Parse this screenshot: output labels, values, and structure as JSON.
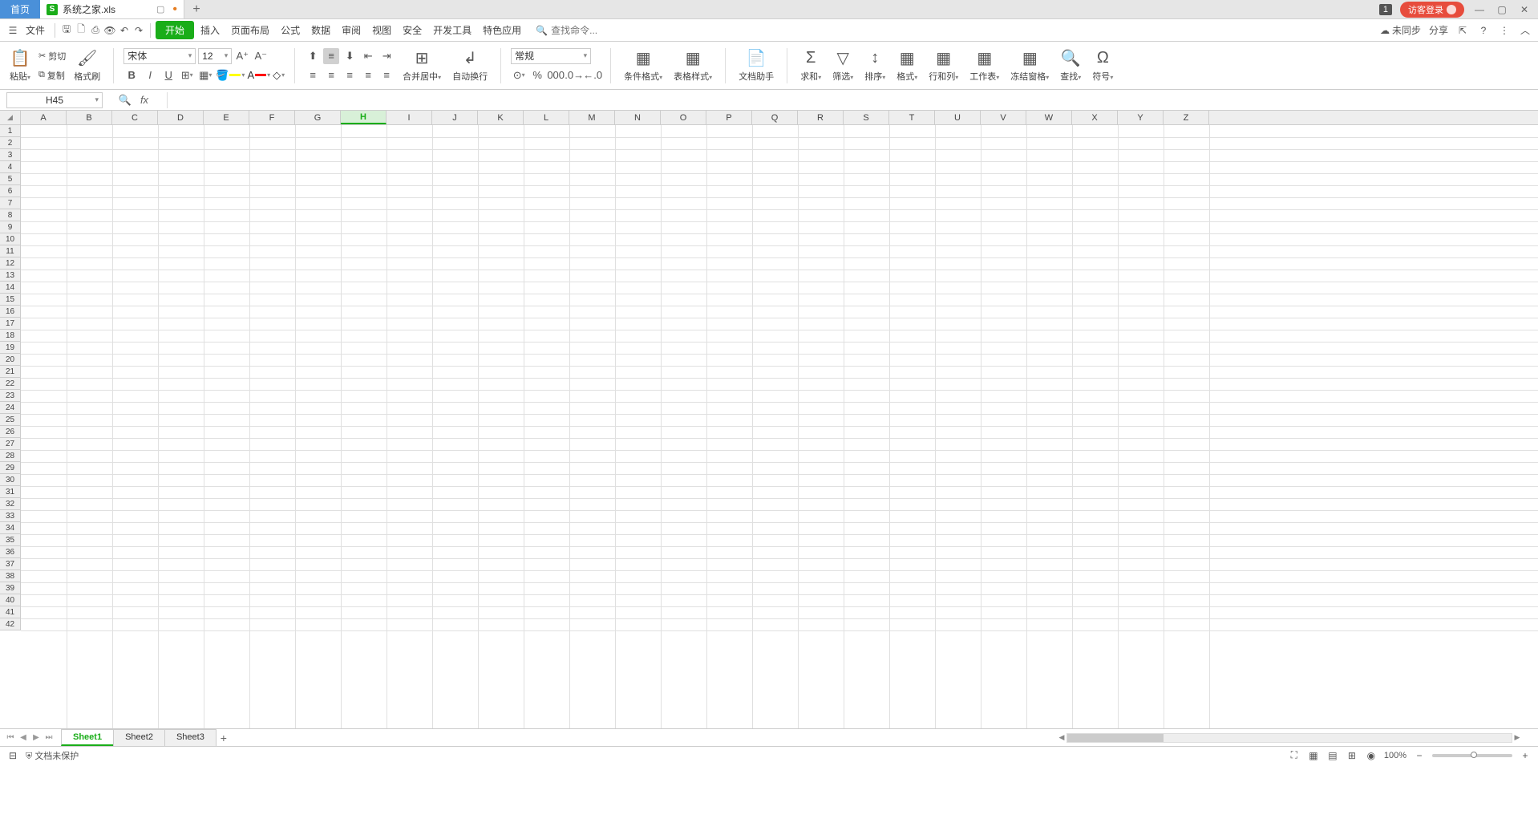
{
  "titlebar": {
    "home_tab": "首页",
    "file_tab": "系统之家.xls",
    "badge": "1",
    "login": "访客登录"
  },
  "menubar": {
    "file": "文件",
    "items": [
      "开始",
      "插入",
      "页面布局",
      "公式",
      "数据",
      "审阅",
      "视图",
      "安全",
      "开发工具",
      "特色应用"
    ],
    "search_ph": "查找命令...",
    "sync": "未同步",
    "share": "分享"
  },
  "ribbon": {
    "paste": "粘贴",
    "cut": "剪切",
    "copy": "复制",
    "fmtpaint": "格式刷",
    "font_name": "宋体",
    "font_size": "12",
    "merge": "合并居中",
    "wrap": "自动换行",
    "numfmt": "常规",
    "condfmt": "条件格式",
    "tablestyle": "表格样式",
    "dochelper": "文档助手",
    "sum": "求和",
    "filter": "筛选",
    "sort": "排序",
    "format": "格式",
    "rowcol": "行和列",
    "worksheet": "工作表",
    "freeze": "冻结窗格",
    "find": "查找",
    "symbol": "符号"
  },
  "formula": {
    "cell": "H45"
  },
  "columns": [
    "A",
    "B",
    "C",
    "D",
    "E",
    "F",
    "G",
    "H",
    "I",
    "J",
    "K",
    "L",
    "M",
    "N",
    "O",
    "P",
    "Q",
    "R",
    "S",
    "T",
    "U",
    "V",
    "W",
    "X",
    "Y",
    "Z"
  ],
  "sel_col": "H",
  "rows": 42,
  "sheets": [
    "Sheet1",
    "Sheet2",
    "Sheet3"
  ],
  "active_sheet": "Sheet1",
  "status": {
    "protect": "文档未保护",
    "zoom": "100%"
  }
}
